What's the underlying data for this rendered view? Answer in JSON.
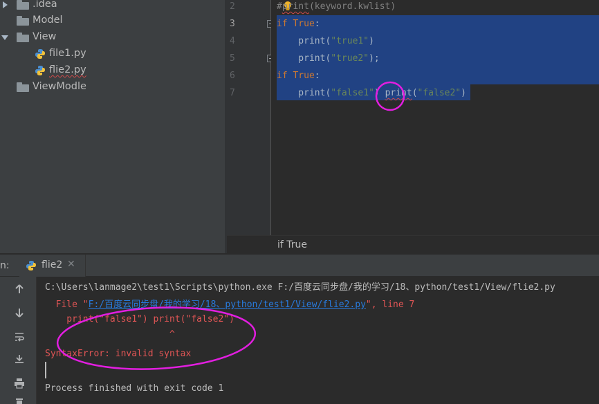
{
  "project_tree": {
    "items": [
      {
        "label": ".idea",
        "kind": "folder",
        "expanded": false
      },
      {
        "label": "Model",
        "kind": "folder",
        "expanded": null
      },
      {
        "label": "View",
        "kind": "folder",
        "expanded": true
      },
      {
        "label": "file1.py",
        "kind": "python-file"
      },
      {
        "label": "flie2.py",
        "kind": "python-file"
      },
      {
        "label": "ViewModle",
        "kind": "folder",
        "expanded": null
      }
    ]
  },
  "editor": {
    "line_numbers": [
      "2",
      "3",
      "4",
      "5",
      "6",
      "7"
    ],
    "current_line": "3",
    "lines": [
      {
        "segments": [
          {
            "t": "#",
            "c": "cm"
          },
          {
            "t": "print",
            "c": "cm wavy"
          },
          {
            "t": "(keyword.kwlist)",
            "c": "cm"
          }
        ]
      },
      {
        "segments": [
          {
            "t": "if",
            "c": "kw"
          },
          {
            "t": " ",
            "c": ""
          },
          {
            "t": "True",
            "c": "kw"
          },
          {
            "t": ":",
            "c": ""
          }
        ]
      },
      {
        "segments": [
          {
            "t": "    print(",
            "c": ""
          },
          {
            "t": "\"true1\"",
            "c": "str"
          },
          {
            "t": ")",
            "c": ""
          }
        ]
      },
      {
        "segments": [
          {
            "t": "    print(",
            "c": ""
          },
          {
            "t": "\"true2\"",
            "c": "str"
          },
          {
            "t": ");",
            "c": ""
          }
        ]
      },
      {
        "segments": [
          {
            "t": "if",
            "c": "kw"
          },
          {
            "t": " ",
            "c": ""
          },
          {
            "t": "True",
            "c": "kw"
          },
          {
            "t": ":",
            "c": ""
          }
        ]
      },
      {
        "segments": [
          {
            "t": "    print(",
            "c": ""
          },
          {
            "t": "\"false1\"",
            "c": "str"
          },
          {
            "t": ") ",
            "c": ""
          },
          {
            "t": "print",
            "c": "wavy"
          },
          {
            "t": "(",
            "c": ""
          },
          {
            "t": "\"false2\"",
            "c": "str"
          },
          {
            "t": ")",
            "c": ""
          }
        ]
      }
    ]
  },
  "breadcrumb": {
    "text": "if True"
  },
  "run_panel": {
    "title_fragment": "n:",
    "tab_label": "flie2",
    "close_glyph": "✕"
  },
  "console": {
    "command": "C:\\Users\\lanmage2\\test1\\Scripts\\python.exe F:/百度云同步盘/我的学习/18、python/test1/View/flie2.py",
    "file_prefix": "  File \"",
    "file_link": "F:/百度云同步盘/我的学习/18、python/test1/View/flie2.py",
    "file_suffix": "\", line 7",
    "code_echo": "    print(\"false1\") print(\"false2\")",
    "caret": "                       ^",
    "error": "SyntaxError: invalid syntax",
    "exit": "Process finished with exit code 1"
  },
  "colors": {
    "annotation": "#e21ee0",
    "selection": "#214283",
    "keyword": "#cc7832",
    "string": "#6a8759",
    "error_text": "#e05555",
    "link": "#287bde"
  },
  "toolbar_icons": [
    "arrow-up-icon",
    "arrow-down-icon",
    "soft-wrap-icon",
    "scroll-to-end-icon",
    "print-icon",
    "delete-icon"
  ]
}
